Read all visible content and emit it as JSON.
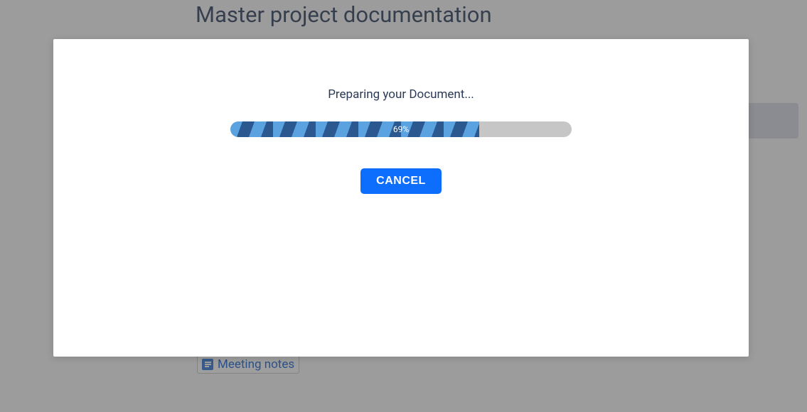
{
  "page": {
    "title": "Master project documentation",
    "doc_link_label": "Meeting notes"
  },
  "modal": {
    "message": "Preparing your Document...",
    "progress_percent": 69,
    "progress_label": "69%",
    "progress_width_style": "width:73%",
    "cancel_label": "CANCEL"
  }
}
